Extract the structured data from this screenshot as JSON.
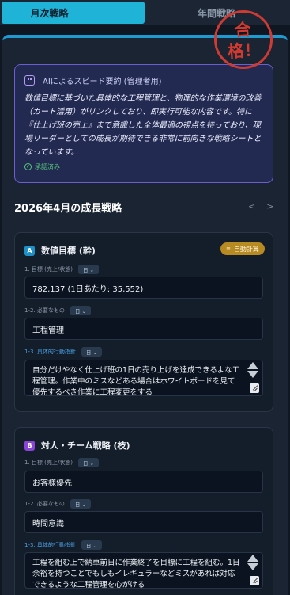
{
  "tabs": {
    "monthly": "月次戦略",
    "annual": "年間戦略"
  },
  "stamp": {
    "line1": "合",
    "line2": "格！"
  },
  "summary": {
    "title": "AIによるスピード要約 (管理者用)",
    "body": "数値目標に基づいた具体的な工程管理と、物理的な作業環境の改善（カート活用）がリンクしており、即実行可能な内容です。特に『仕上げ班の売上』まで意識した全体最適の視点を持っており、現場リーダーとしての成長が期待できる非常に前向きな戦略シートとなっています。",
    "status": "承認済み"
  },
  "month_title": "2026年4月の成長戦略",
  "nav": {
    "prev": "<",
    "next": ">"
  },
  "cards": [
    {
      "badge": "A",
      "title": "数値目標 (幹)",
      "auto_label": "自動計算",
      "goal_label": "1. 目標 (売上/状態)",
      "goal_pill": "日 ⌄",
      "goal_value": "782,137 (1日あたり: 35,552)",
      "need_label": "1-2. 必要なもの",
      "need_pill": "日 ⌄",
      "need_value": "工程管理",
      "action_label": "1-3. 具体的行動指針",
      "action_pill": "日 ⌄",
      "action_value": "自分だけやなく仕上げ班の1日の売り上げを達成できるよな工程管理。作業中のミスなどある場合はホワイトボードを見て優先するべき作業に工程変更をする"
    },
    {
      "badge": "B",
      "title": "対人・チーム戦略 (枝)",
      "goal_label": "1. 目標 (売上/状態)",
      "goal_pill": "日 ⌄",
      "goal_value": "お客様優先",
      "need_label": "1-2. 必要なもの",
      "need_pill": "日 ⌄",
      "need_value": "時間意識",
      "action_label": "1-3. 具体的行動指針",
      "action_pill": "日 ⌄",
      "action_value": "工程を組む上で納車前日に作業終了を目標に工程を組む。1日余裕を持つことでもしもイレギュラーなどミスがあれば対応できるような工程管理を心がける"
    }
  ]
}
